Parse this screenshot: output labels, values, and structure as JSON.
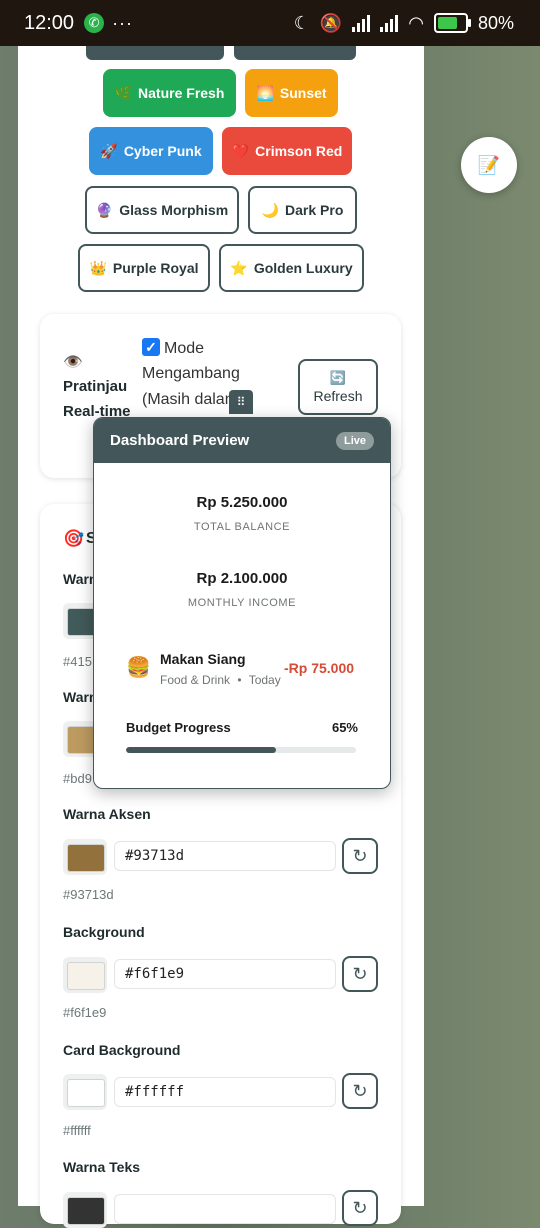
{
  "status": {
    "time": "12:00",
    "battery": "80%"
  },
  "themes": [
    {
      "label": "Nature Fresh",
      "icon": "🌿"
    },
    {
      "label": "Sunset",
      "icon": "🌅"
    },
    {
      "label": "Cyber Punk",
      "icon": "🚀"
    },
    {
      "label": "Crimson Red",
      "icon": "❤️"
    },
    {
      "label": "Glass Morphism",
      "icon": "🔮"
    },
    {
      "label": "Dark Pro",
      "icon": "🌙"
    },
    {
      "label": "Purple Royal",
      "icon": "👑"
    },
    {
      "label": "Golden Luxury",
      "icon": "⭐"
    }
  ],
  "preview_toggle": {
    "eye_icon": "👁️",
    "title_line1": "Pratinjau",
    "title_line2": "Real-time",
    "checkbox_label_line1": "Mode",
    "checkbox_label_line2": "Mengambang",
    "checkbox_label_line3": "(Masih dalam",
    "checked": true,
    "refresh_icon": "🔄",
    "refresh_label": "Refresh"
  },
  "settings_section": {
    "icon": "🎯",
    "title_partial": "S",
    "partial_rows": [
      {
        "label": "Warn",
        "hex": "#415",
        "swatch": "#415a5a"
      },
      {
        "label": "Warn",
        "hex": "#bd9",
        "swatch": "#bd9a60"
      }
    ],
    "rows": [
      {
        "label": "Warna Aksen",
        "value": "#93713d",
        "hex": "#93713d",
        "swatch": "#93713d"
      },
      {
        "label": "Background",
        "value": "#f6f1e9",
        "hex": "#f6f1e9",
        "swatch": "#f6f1e9"
      },
      {
        "label": "Card Background",
        "value": "#ffffff",
        "hex": "#ffffff",
        "swatch": "#ffffff"
      },
      {
        "label": "Warna Teks",
        "value": "",
        "hex": "",
        "swatch": "#333333"
      }
    ]
  },
  "dashboard_preview": {
    "title": "Dashboard Preview",
    "badge": "Live",
    "total_balance": "Rp 5.250.000",
    "total_balance_label": "TOTAL BALANCE",
    "monthly_income": "Rp 2.100.000",
    "monthly_income_label": "MONTHLY INCOME",
    "transaction": {
      "icon": "🍔",
      "name": "Makan Siang",
      "category": "Food & Drink",
      "separator": "•",
      "time": "Today",
      "amount": "-Rp 75.000"
    },
    "budget_label": "Budget Progress",
    "budget_percent_text": "65%",
    "budget_fraction": 0.65
  },
  "fab_icon": "📝",
  "colors": {
    "primary": "#43575a",
    "nature": "#1fa855",
    "sunset": "#f5a10f",
    "cyber": "#3391de",
    "crimson": "#e94a3c",
    "negative": "#d64b35"
  }
}
